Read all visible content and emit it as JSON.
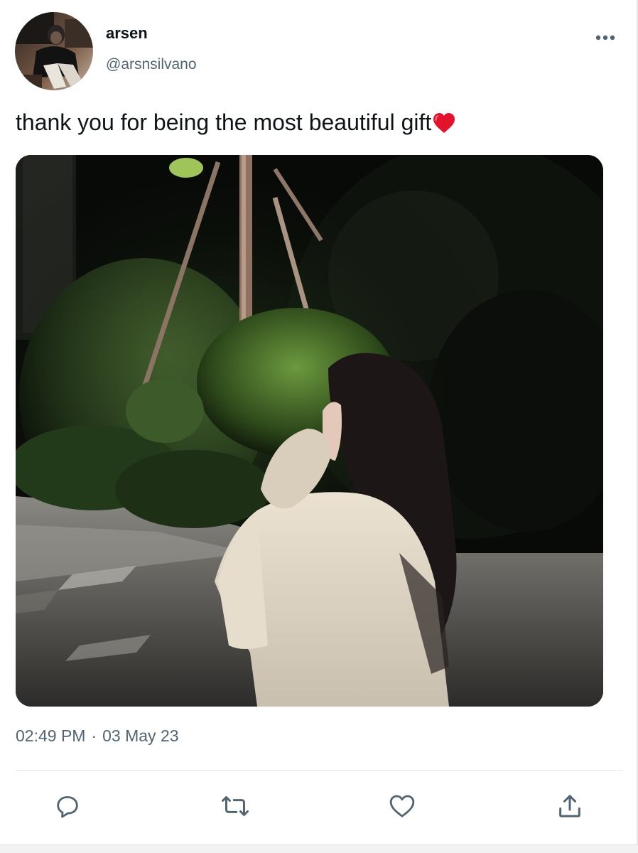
{
  "author": {
    "display_name": "arsen",
    "handle": "@arsnsilvano"
  },
  "tweet": {
    "text": "thank you for being the most beautiful gift",
    "emoji": "red-heart-emoji"
  },
  "meta": {
    "time": "02:49 PM",
    "separator": "·",
    "date": "03 May 23"
  },
  "actions": {
    "reply_icon": "reply-icon",
    "retweet_icon": "retweet-icon",
    "like_icon": "like-icon",
    "share_icon": "share-icon"
  },
  "colors": {
    "text": "#0f1419",
    "secondary": "#536471",
    "heart": "#e0245e"
  }
}
